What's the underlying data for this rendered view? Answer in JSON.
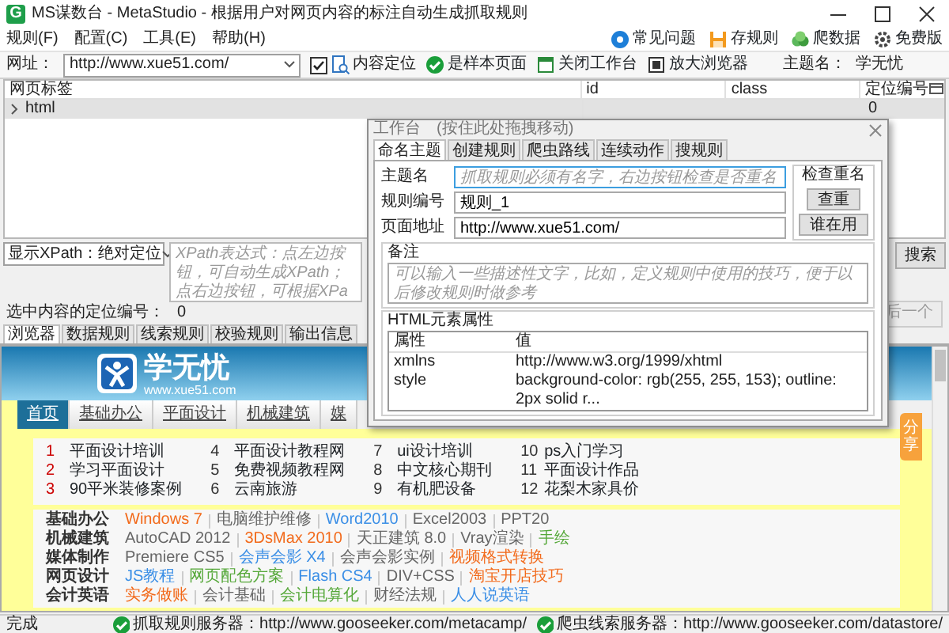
{
  "window": {
    "title": "MS谋数台 - MetaStudio - 根据用户对网页内容的标注自动生成抓取规则",
    "app_icon": "G"
  },
  "menu": [
    {
      "label": "规则(F)"
    },
    {
      "label": "配置(C)"
    },
    {
      "label": "工具(E)"
    },
    {
      "label": "帮助(H)"
    }
  ],
  "quick_links": [
    {
      "kind": "help",
      "label": "常见问题"
    },
    {
      "kind": "save",
      "label": "存规则"
    },
    {
      "kind": "crawl",
      "label": "爬数据"
    },
    {
      "kind": "gear",
      "label": "免费版"
    }
  ],
  "toolbar": {
    "url_label": "网址：",
    "url": "http://www.xue51.com/",
    "locate": {
      "label": "内容定位",
      "checked": true
    },
    "buttons": [
      {
        "kind": "check",
        "label": "是样本页面"
      },
      {
        "kind": "window",
        "label": "关闭工作台"
      },
      {
        "kind": "zoom",
        "label": "放大浏览器"
      }
    ],
    "theme_label": "主题名：",
    "theme": "学无忧"
  },
  "tree_table": {
    "columns": [
      "网页标签",
      "id",
      "class",
      "定位编号"
    ],
    "rows": [
      {
        "tag": "html",
        "locator": "0",
        "expanded": false,
        "selected": true
      }
    ]
  },
  "xpath": {
    "mode": "显示XPath：绝对定位",
    "placeholder": "XPath表达式：点左边按钮，可自动生成XPath；点右边按钮，可根据XPa",
    "search": "搜索"
  },
  "selection": {
    "label": "选中内容的定位编号：",
    "value": "0",
    "next": {
      "label": "后一个",
      "disabled": true
    }
  },
  "bottom_tabs": [
    {
      "label": "浏览器",
      "selected": true
    },
    {
      "label": "数据规则",
      "selected": false
    },
    {
      "label": "线索规则",
      "selected": false
    },
    {
      "label": "校验规则",
      "selected": false
    },
    {
      "label": "输出信息",
      "selected": false
    }
  ],
  "site": {
    "logo": "学无忧",
    "domain": "www.xue51.com",
    "nav": [
      {
        "label": "首页",
        "selected": true
      },
      {
        "label": "基础办公",
        "selected": false
      },
      {
        "label": "平面设计",
        "selected": false
      },
      {
        "label": "机械建筑",
        "selected": false
      },
      {
        "label": "媒",
        "selected": false
      }
    ],
    "hot_links": [
      {
        "num": "1",
        "text": "平面设计培训",
        "color": "#cc0000"
      },
      {
        "num": "2",
        "text": "学习平面设计",
        "color": "#cc0000"
      },
      {
        "num": "3",
        "text": "90平米装修案例",
        "color": "#cc0000"
      },
      {
        "num": "4",
        "text": "平面设计教程网",
        "color": "#333333"
      },
      {
        "num": "5",
        "text": "免费视频教程网",
        "color": "#333333"
      },
      {
        "num": "6",
        "text": "云南旅游",
        "color": "#333333"
      },
      {
        "num": "7",
        "text": "ui设计培训",
        "color": "#333333"
      },
      {
        "num": "8",
        "text": "中文核心期刊",
        "color": "#333333"
      },
      {
        "num": "9",
        "text": "有机肥设备",
        "color": "#333333"
      },
      {
        "num": "10",
        "text": "ps入门学习",
        "color": "#333333"
      },
      {
        "num": "11",
        "text": "平面设计作品",
        "color": "#333333"
      },
      {
        "num": "12",
        "text": "花梨木家具价",
        "color": "#333333"
      }
    ],
    "categories": [
      {
        "name": "基础办公",
        "links": [
          {
            "text": "Windows 7",
            "color": "#f26a1b"
          },
          {
            "text": "电脑维护维修",
            "color": "#666666"
          },
          {
            "text": "Word2010",
            "color": "#3a8ee6"
          },
          {
            "text": "Excel2003",
            "color": "#666666"
          },
          {
            "text": "PPT20",
            "color": "#666666"
          }
        ]
      },
      {
        "name": "机械建筑",
        "links": [
          {
            "text": "AutoCAD 2012",
            "color": "#666666"
          },
          {
            "text": "3DsMax 2010",
            "color": "#f26a1b"
          },
          {
            "text": "天正建筑 8.0",
            "color": "#666666"
          },
          {
            "text": "Vray渲染",
            "color": "#666666"
          },
          {
            "text": "手绘",
            "color": "#56a83a"
          }
        ]
      },
      {
        "name": "媒体制作",
        "links": [
          {
            "text": "Premiere CS5",
            "color": "#666666"
          },
          {
            "text": "会声会影 X4",
            "color": "#3a8ee6"
          },
          {
            "text": "会声会影实例",
            "color": "#666666"
          },
          {
            "text": "视频格式转换",
            "color": "#f26a1b"
          }
        ]
      },
      {
        "name": "网页设计",
        "links": [
          {
            "text": "JS教程",
            "color": "#3a8ee6"
          },
          {
            "text": "网页配色方案",
            "color": "#56a83a"
          },
          {
            "text": "Flash CS4",
            "color": "#3a8ee6"
          },
          {
            "text": "DIV+CSS",
            "color": "#666666"
          },
          {
            "text": "淘宝开店技巧",
            "color": "#f26a1b"
          }
        ]
      },
      {
        "name": "会计英语",
        "links": [
          {
            "text": "实务做账",
            "color": "#f26a1b"
          },
          {
            "text": "会计基础",
            "color": "#666666"
          },
          {
            "text": "会计电算化",
            "color": "#56a83a"
          },
          {
            "text": "财经法规",
            "color": "#666666"
          },
          {
            "text": "人人说英语",
            "color": "#3a8ee6"
          }
        ]
      }
    ],
    "share": "分享"
  },
  "workbench": {
    "title": "工作台",
    "hint": "(按住此处拖拽移动)",
    "tabs": [
      {
        "label": "命名主题",
        "selected": true
      },
      {
        "label": "创建规则",
        "selected": false
      },
      {
        "label": "爬虫路线",
        "selected": false
      },
      {
        "label": "连续动作",
        "selected": false
      },
      {
        "label": "搜规则",
        "selected": false
      }
    ],
    "fields": [
      {
        "label": "主题名",
        "placeholder": "抓取规则必须有名字，右边按钮检查是否重名",
        "focused": true
      },
      {
        "label": "规则编号",
        "value": "规则_1",
        "focused": false
      },
      {
        "label": "页面地址",
        "value": "http://www.xue51.com/",
        "focused": false
      }
    ],
    "check_group": {
      "title": "检查重名",
      "buttons": [
        "查重",
        "谁在用"
      ]
    },
    "note": {
      "title": "备注",
      "placeholder": "可以输入一些描述性文字，比如，定义规则中使用的技巧，便于以后修改规则时做参考"
    },
    "attributes": {
      "title": "HTML元素属性",
      "columns": [
        "属性",
        "值"
      ],
      "rows": [
        {
          "name": "xmlns",
          "value": "http://www.w3.org/1999/xhtml"
        },
        {
          "name": "style",
          "value": "background-color: rgb(255, 255, 153); outline: 2px solid r..."
        }
      ]
    }
  },
  "status_bar": {
    "text": "完成",
    "servers": [
      {
        "label": "抓取规则服务器：http://www.gooseeker.com/metacamp/",
        "ok": true
      },
      {
        "label": "爬虫线索服务器：http://www.gooseeker.com/datastore/",
        "ok": true
      }
    ]
  }
}
